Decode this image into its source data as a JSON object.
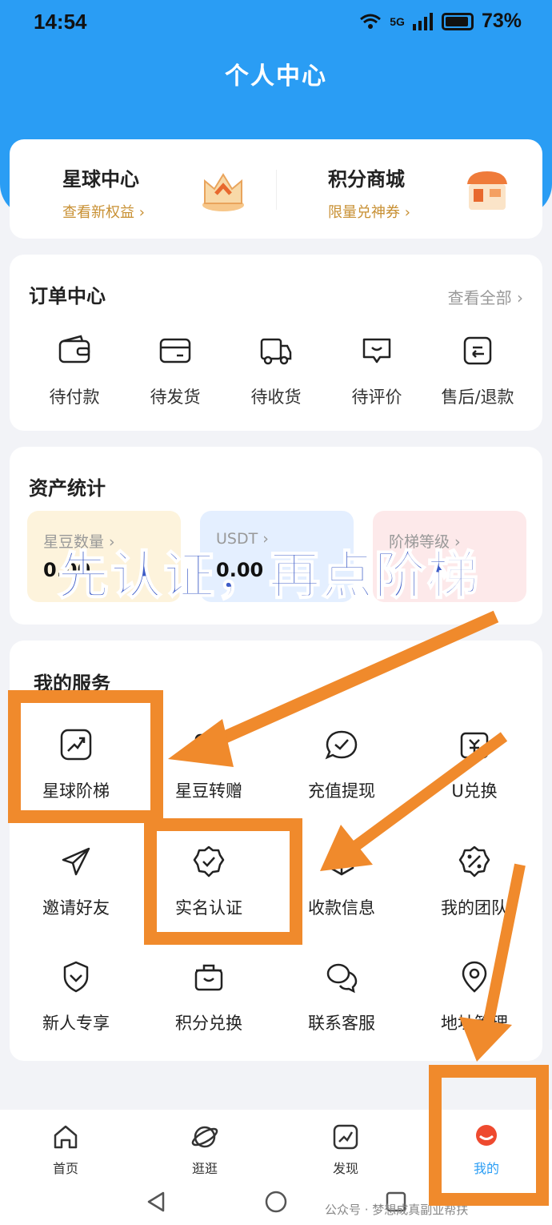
{
  "status_bar": {
    "time": "14:54",
    "network": "5G",
    "battery": "73%"
  },
  "header": {
    "title": "个人中心"
  },
  "promo": [
    {
      "title": "星球中心",
      "subtitle": "查看新权益 ›"
    },
    {
      "title": "积分商城",
      "subtitle": "限量兑神券 ›"
    }
  ],
  "orders": {
    "title": "订单中心",
    "view_all": "查看全部 ›",
    "items": [
      {
        "label": "待付款",
        "icon": "wallet-icon"
      },
      {
        "label": "待发货",
        "icon": "card-icon"
      },
      {
        "label": "待收货",
        "icon": "truck-icon"
      },
      {
        "label": "待评价",
        "icon": "comment-icon"
      },
      {
        "label": "售后/退款",
        "icon": "return-icon"
      }
    ]
  },
  "assets": {
    "title": "资产统计",
    "items": [
      {
        "label": "星豆数量 ›",
        "value": "0.00",
        "color": "#fdf3dc"
      },
      {
        "label": "USDT ›",
        "value": "0.00",
        "color": "#e4efff"
      },
      {
        "label": "阶梯等级 ›",
        "value": "",
        "color": "#fde9ea"
      }
    ]
  },
  "services": {
    "title": "我的服务",
    "items": [
      {
        "label": "星球阶梯",
        "icon": "chart-icon"
      },
      {
        "label": "星豆转赠",
        "icon": "gift-icon"
      },
      {
        "label": "充值提现",
        "icon": "check-bubble-icon"
      },
      {
        "label": "U兑换",
        "icon": "exchange-icon"
      },
      {
        "label": "邀请好友",
        "icon": "send-icon"
      },
      {
        "label": "实名认证",
        "icon": "badge-check-icon"
      },
      {
        "label": "收款信息",
        "icon": "payment-icon"
      },
      {
        "label": "我的团队",
        "icon": "percent-badge-icon"
      },
      {
        "label": "新人专享",
        "icon": "shield-heart-icon"
      },
      {
        "label": "积分兑换",
        "icon": "basket-icon"
      },
      {
        "label": "联系客服",
        "icon": "chat-icon"
      },
      {
        "label": "地址管理",
        "icon": "location-icon"
      }
    ]
  },
  "tabs": [
    {
      "label": "首页",
      "icon": "home-icon"
    },
    {
      "label": "逛逛",
      "icon": "planet-icon"
    },
    {
      "label": "发现",
      "icon": "chart-icon"
    },
    {
      "label": "我的",
      "icon": "user-icon",
      "active": true
    }
  ],
  "overlay": {
    "text": "先认证，再点阶梯",
    "accent": "#f08a2c",
    "text_color": "#3d5cc7"
  },
  "watermark": "公众号 · 梦想成真副业帮扶"
}
